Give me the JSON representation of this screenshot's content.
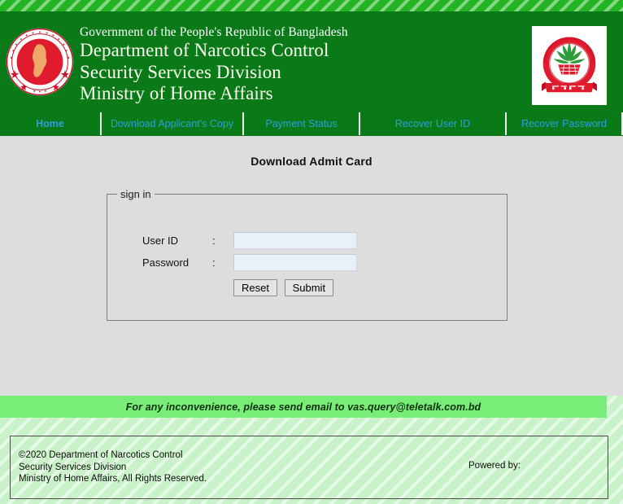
{
  "header": {
    "emblem_icon": "bangladesh-national-emblem",
    "dnc_logo_icon": "department-of-narcotics-control-logo",
    "government_line": "Government of the People's Republic of Bangladesh",
    "department_line": "Department of Narcotics Control",
    "division_line": "Security Services Division",
    "ministry_line": "Ministry of Home Affairs",
    "header_bg_color": "#0a7a18",
    "title_color": "#fdfdf0"
  },
  "nav": {
    "items": [
      {
        "label": "Home",
        "active": true
      },
      {
        "label": "Download Applicant's Copy",
        "active": false
      },
      {
        "label": "Payment Status",
        "active": false
      },
      {
        "label": "Recover User ID",
        "active": false
      },
      {
        "label": "Recover Password",
        "active": false
      }
    ],
    "link_color": "#2e9ddb"
  },
  "main": {
    "page_title": "Download Admit Card",
    "panel_bg_color": "#dddddd",
    "form": {
      "legend": "sign in",
      "fields": [
        {
          "label": "User ID",
          "separator": ":",
          "value": "",
          "placeholder": ""
        },
        {
          "label": "Password",
          "separator": ":",
          "value": "",
          "placeholder": ""
        }
      ],
      "reset_label": "Reset",
      "submit_label": "Submit",
      "input_bg_color": "#e9f0f8"
    }
  },
  "notice": {
    "text": "For any inconvenience, please send email to vas.query@teletalk.com.bd",
    "bar_color": "#78ee78"
  },
  "footer": {
    "copyright_line1": "©2020 Department of Narcotics Control",
    "copyright_line2": "Security Services Division",
    "copyright_line3": "Ministry of Home Affairs, All Rights Reserved.",
    "powered_by_label": "Powered by:"
  }
}
